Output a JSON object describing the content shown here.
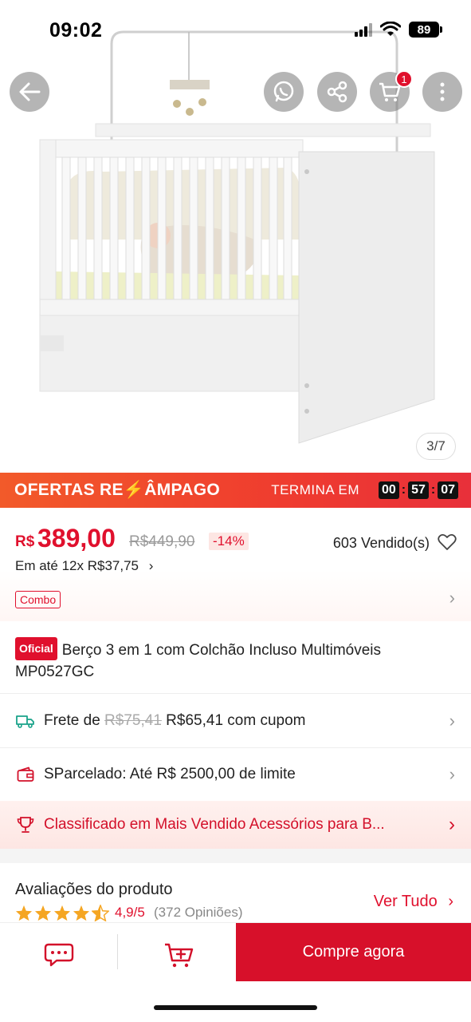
{
  "status_bar": {
    "time": "09:02",
    "battery": "89"
  },
  "gallery": {
    "counter": "3/7"
  },
  "header": {
    "cart_count": "1"
  },
  "flash_sale": {
    "title": "OFERTAS RE⚡ÂMPAGO",
    "ends_label": "TERMINA EM",
    "timer": {
      "hours": "00",
      "minutes": "57",
      "seconds": "07"
    }
  },
  "price": {
    "currency": "R$",
    "current": "389,00",
    "original": "R$449,90",
    "discount": "-14%",
    "sold": "603 Vendido(s)",
    "installments": "Em até 12x R$37,75"
  },
  "combo_label": "Combo",
  "product": {
    "official_badge": "Oficial",
    "title": "Berço 3 em 1 com Colchão Incluso Multimóveis MP0527GC"
  },
  "shipping": {
    "prefix": "Frete de",
    "old": "R$75,41",
    "new": "R$65,41 com cupom"
  },
  "sparcelado": {
    "text": "SParcelado: Até R$ 2500,00 de limite"
  },
  "ranking": {
    "text": "Classificado em Mais Vendido Acessórios para B..."
  },
  "reviews": {
    "title": "Avaliações do produto",
    "rating": "4,9/5",
    "opinions": "(372 Opiniões)",
    "see_all": "Ver Tudo",
    "stars": 4.9
  },
  "bottom_bar": {
    "buy_label": "Compre agora"
  },
  "colors": {
    "accent": "#e0102d",
    "buy_button": "#d7102a",
    "flash_banner": "#f25a2a"
  },
  "icons": [
    "back-arrow-icon",
    "whatsapp-icon",
    "share-icon",
    "cart-icon",
    "more-icon",
    "heart-icon",
    "truck-icon",
    "wallet-icon",
    "trophy-icon",
    "star-icon",
    "chat-icon",
    "add-to-cart-icon"
  ]
}
